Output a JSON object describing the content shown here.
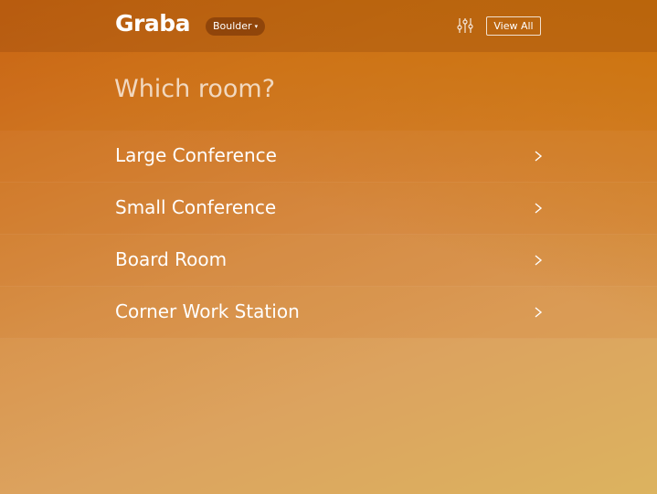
{
  "header": {
    "logo": "Graba",
    "city": "Boulder",
    "city_caret": "˅",
    "view_all": "View All",
    "filter_icon": "sliders-icon"
  },
  "page": {
    "title": "Which room?"
  },
  "rooms": [
    {
      "label": "Large Conference",
      "icon": "chevron-right-icon"
    },
    {
      "label": "Small Conference",
      "icon": "chevron-right-icon"
    },
    {
      "label": "Board Room",
      "icon": "chevron-right-icon"
    },
    {
      "label": "Corner Work Station",
      "icon": "chevron-right-icon"
    }
  ],
  "colors": {
    "gradient_top": "#c9651c",
    "gradient_bottom": "#dcb35f",
    "text": "#ffffff"
  }
}
